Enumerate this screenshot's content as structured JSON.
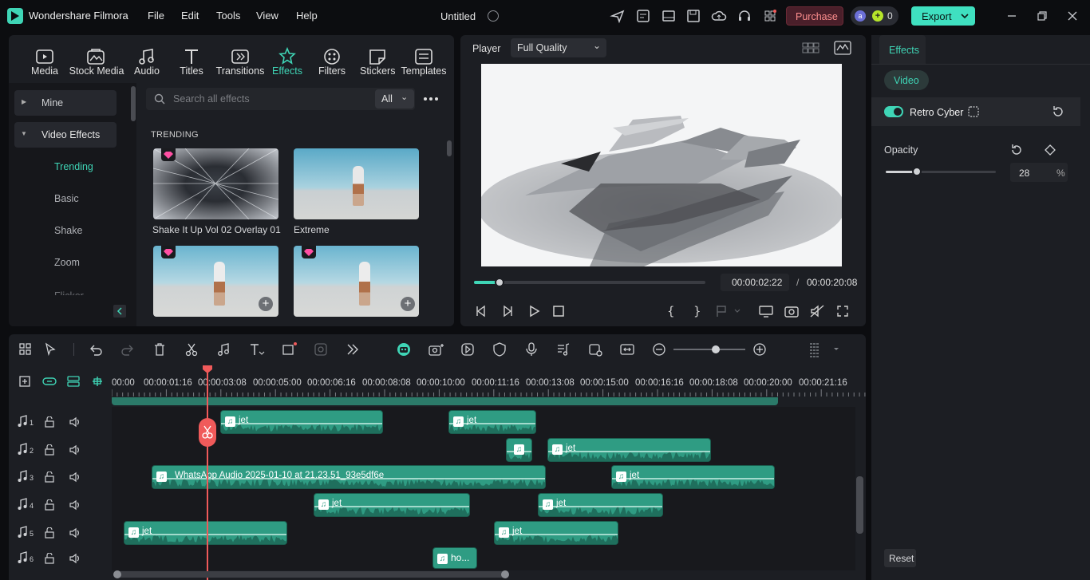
{
  "app": {
    "name": "Wondershare Filmora",
    "doc_title": "Untitled"
  },
  "menu": [
    "File",
    "Edit",
    "Tools",
    "View",
    "Help"
  ],
  "titlebar": {
    "purchase": "Purchase",
    "credits": "0",
    "export": "Export"
  },
  "media_tabs": [
    "Media",
    "Stock Media",
    "Audio",
    "Titles",
    "Transitions",
    "Effects",
    "Filters",
    "Stickers",
    "Templates"
  ],
  "sidebar": {
    "mine": "Mine",
    "video_effects": "Video Effects",
    "items": [
      "Trending",
      "Basic",
      "Shake",
      "Zoom",
      "Flicker"
    ]
  },
  "search": {
    "placeholder": "Search all effects",
    "filter": "All"
  },
  "effects": {
    "section": "TRENDING",
    "items": [
      "Shake It Up Vol 02 Overlay 01",
      "Extreme"
    ]
  },
  "player": {
    "label": "Player",
    "quality": "Full Quality",
    "current_time": "00:00:02:22",
    "separator": "/",
    "total_time": "00:00:20:08",
    "progress": 0.11
  },
  "inspector": {
    "tab": "Effects",
    "subtab": "Video",
    "effect_name": "Retro Cyber",
    "opacity_label": "Opacity",
    "opacity_value": "28",
    "opacity_unit": "%",
    "opacity_fraction": 0.28,
    "reset": "Reset"
  },
  "ruler": [
    "00:00",
    "00:00:01:16",
    "00:00:03:08",
    "00:00:05:00",
    "00:00:06:16",
    "00:00:08:08",
    "00:00:10:00",
    "00:00:11:16",
    "00:00:13:08",
    "00:00:15:00",
    "00:00:16:16",
    "00:00:18:08",
    "00:00:20:00",
    "00:00:21:16"
  ],
  "tracks": [
    {
      "num": "1"
    },
    {
      "num": "2"
    },
    {
      "num": "3"
    },
    {
      "num": "4"
    },
    {
      "num": "5"
    },
    {
      "num": "6"
    }
  ],
  "clips": {
    "jet": "jet",
    "whatsapp": "WhatsApp Audio 2025-01-10 at 21.23.51_93e5df6e",
    "ho": "ho..."
  },
  "colors": {
    "accent": "#3fd5b6",
    "clip": "#2f9c83",
    "playhead": "#f05a5a",
    "purchase_bg": "#4a1f2a",
    "purchase_text": "#ff8f8f",
    "export_bg": "#3fe0c0"
  }
}
